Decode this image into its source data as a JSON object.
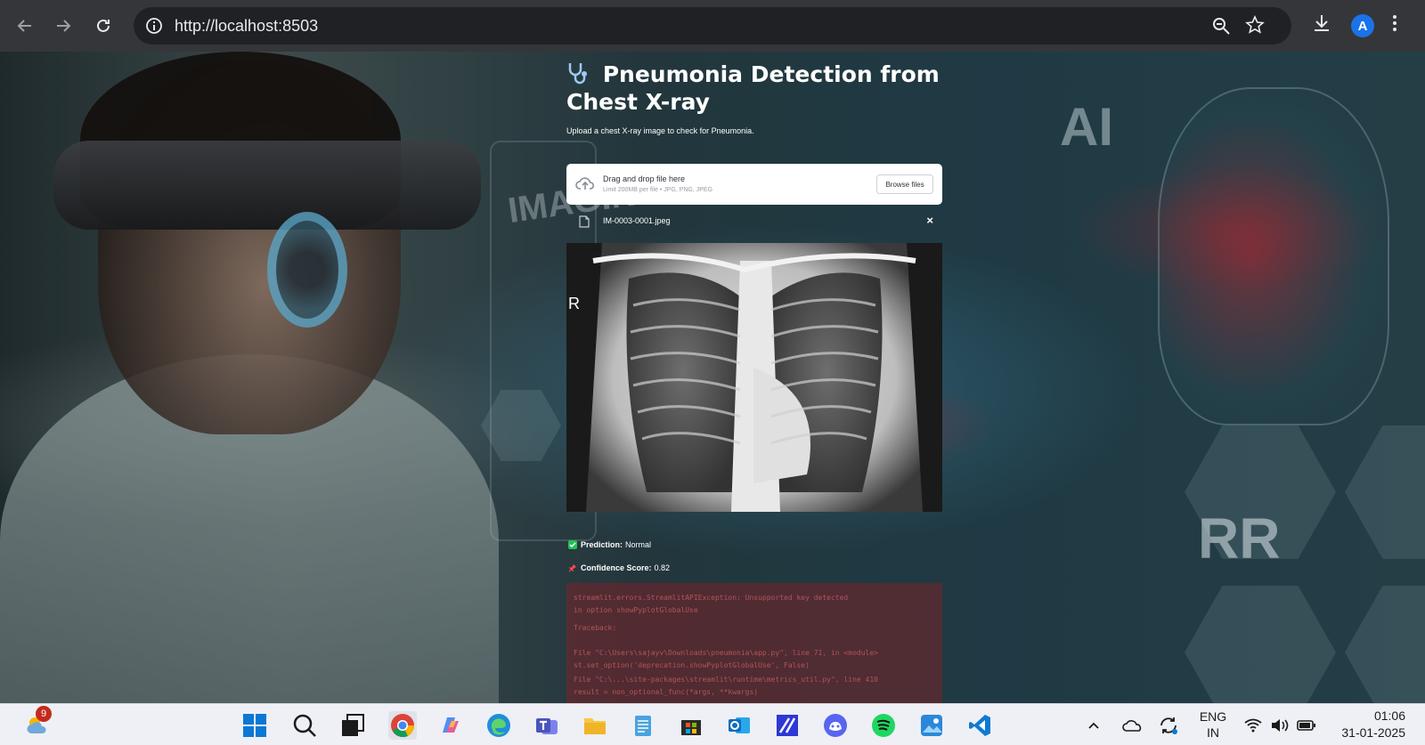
{
  "browser": {
    "url": "http://localhost:8503",
    "profile_initial": "A",
    "icons": [
      "back-icon",
      "forward-icon",
      "reload-icon",
      "site-info-icon",
      "zoom-icon",
      "bookmark-star-icon",
      "download-icon",
      "menu-icon"
    ]
  },
  "background": {
    "ai_text": "AI",
    "imaging_text": "IMAGING",
    "hex_text": "RR"
  },
  "app": {
    "title": "Pneumonia Detection from Chest X-ray",
    "subtitle": "Upload a chest X-ray image to check for Pneumonia.",
    "uploader": {
      "drag_text": "Drag and drop file here",
      "limit_text": "Limit 200MB per file • JPG, PNG, JPEG",
      "browse_label": "Browse files"
    },
    "file": {
      "name": "IM-0003-0001.jpeg",
      "close": "×"
    },
    "xray_marker": "R",
    "prediction_label": "Prediction:",
    "prediction_value": "Normal",
    "confidence_label": "Confidence Score:",
    "confidence_value": "0.82",
    "error_lines": [
      "streamlit.errors.StreamlitAPIException: Unsupported key detected",
      "in option showPyplotGlobalUse",
      "Traceback:",
      "File \"C:\\Users\\sajayv\\Downloads\\pneumonia\\app.py\", line 71, in <module>",
      "    st.set_option('deprecation.showPyplotGlobalUse', False)",
      "File \"C:\\...\\site-packages\\streamlit\\runtime\\metrics_util.py\", line 410",
      "    result = non_optional_func(*args, **kwargs)"
    ]
  },
  "taskbar": {
    "weather_badge": "9",
    "apps": [
      "start-icon",
      "search-icon",
      "task-view-icon",
      "chrome-icon",
      "copilot-icon",
      "edge-icon",
      "teams-icon",
      "file-explorer-icon",
      "notepad-icon",
      "store-icon",
      "outlook-icon",
      "ide-icon",
      "discord-icon",
      "spotify-icon",
      "photos-icon",
      "vscode-icon"
    ],
    "tray": {
      "lang_line1": "ENG",
      "lang_line2": "IN",
      "time": "01:06",
      "date": "31-01-2025"
    }
  },
  "colors": {
    "browser_bar": "#35363a",
    "omnibox": "#202124",
    "success_green": "#21c354",
    "error_red": "#ff4b4b",
    "taskbar": "#eef0f6"
  }
}
